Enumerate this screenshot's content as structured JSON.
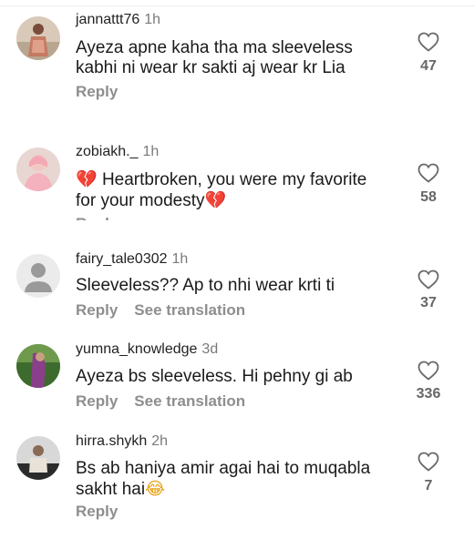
{
  "comments": [
    {
      "username": "jannattt76",
      "time": "1h",
      "text": "Ayeza apne kaha tha ma sleeveless kabhi ni wear kr sakti aj wear kr Lia",
      "reply": "Reply",
      "likes": "47"
    },
    {
      "username": "zobiakh._",
      "time": "1h",
      "emoji_prefix": "💔",
      "text": " Heartbroken, you were my favorite for your modesty",
      "emoji_suffix": "💔",
      "reply": "Reply",
      "likes": "58"
    },
    {
      "username": "fairy_tale0302",
      "time": "1h",
      "text": "Sleeveless?? Ap to nhi wear krti ti",
      "reply": "Reply",
      "see_translation": "See translation",
      "likes": "37"
    },
    {
      "username": "yumna_knowledge",
      "time": "3d",
      "text": "Ayeza bs sleeveless. Hi pehny gi ab",
      "reply": "Reply",
      "see_translation": "See translation",
      "likes": "336"
    },
    {
      "username": "hirra.shykh",
      "time": "2h",
      "text": "Bs ab haniya amir agai hai to muqabla sakht hai",
      "emoji_suffix": "😂",
      "reply": "Reply",
      "likes": "7"
    }
  ],
  "icons": {
    "like": "heart-outline-icon",
    "default_avatar": "default-user-avatar"
  },
  "colors": {
    "text": "#1a1a1a",
    "muted": "#8e8e8e",
    "heart_emoji": "#e0245e"
  }
}
